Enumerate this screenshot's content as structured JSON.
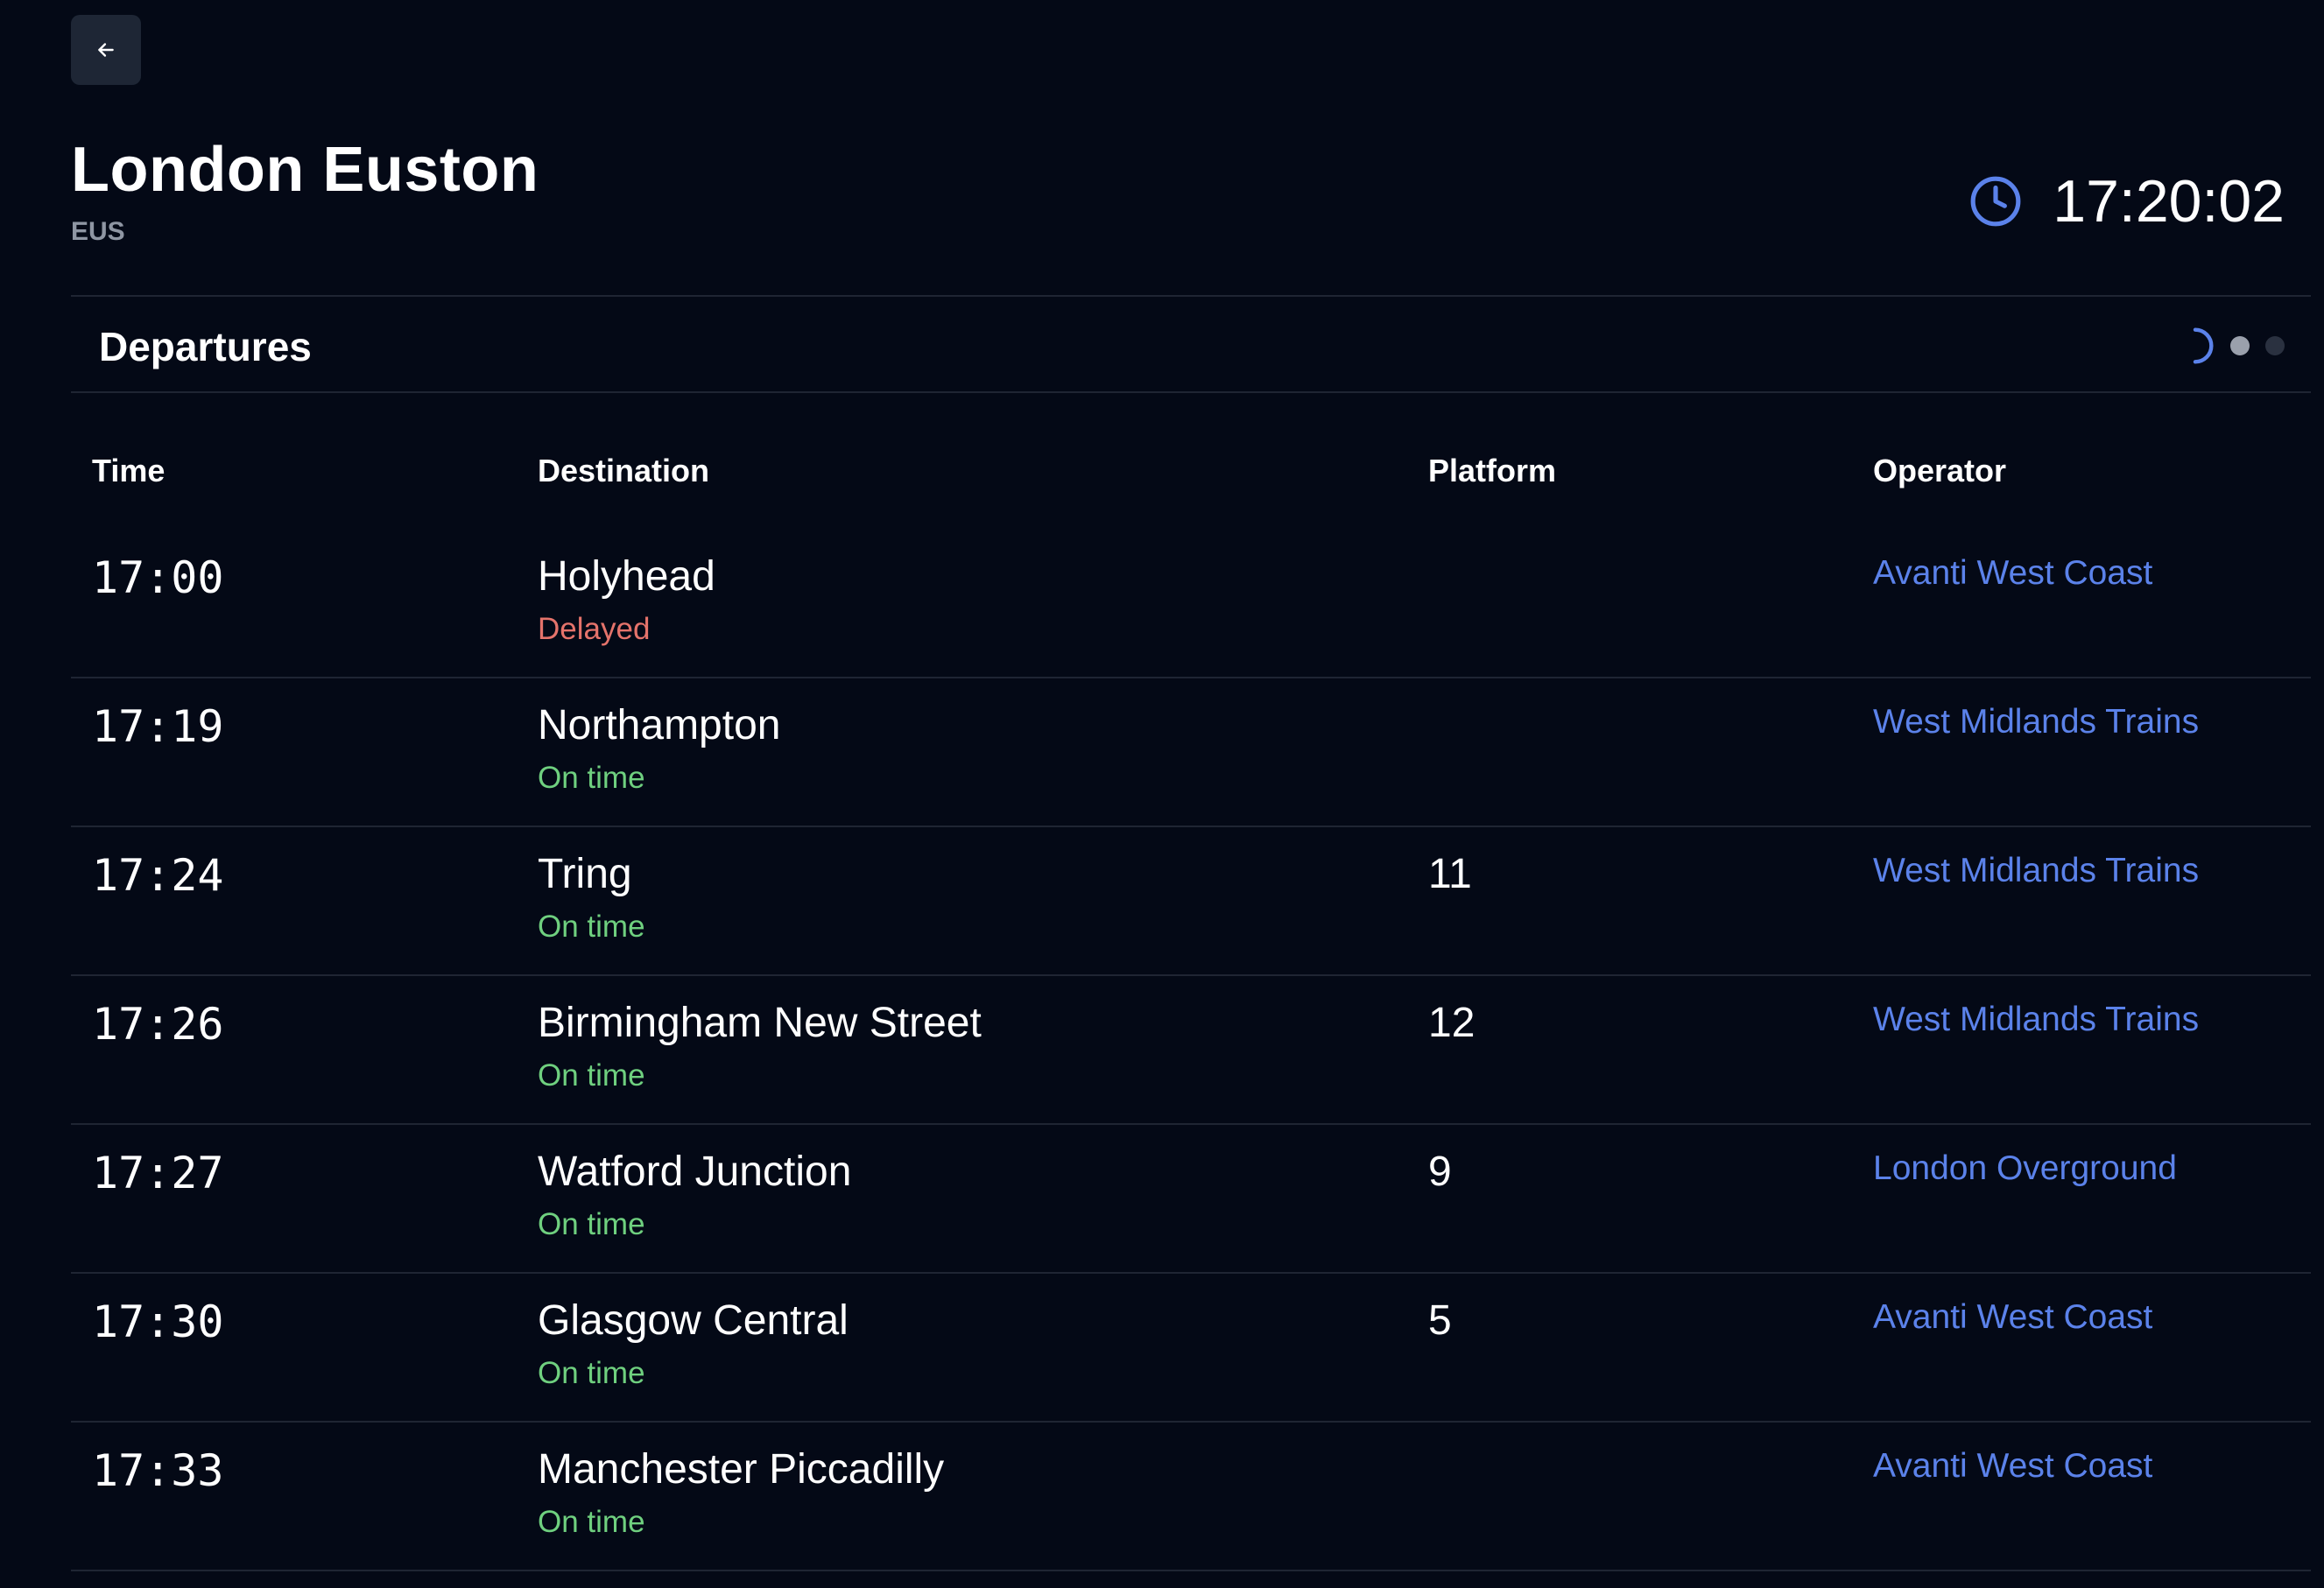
{
  "header": {
    "station_name": "London Euston",
    "station_code": "EUS",
    "current_time": "17:20:02"
  },
  "section": {
    "title": "Departures"
  },
  "columns": {
    "time": "Time",
    "destination": "Destination",
    "platform": "Platform",
    "operator": "Operator"
  },
  "departures": [
    {
      "time": "17:00",
      "destination": "Holyhead",
      "status": "Delayed",
      "platform": "",
      "operator": "Avanti West Coast"
    },
    {
      "time": "17:19",
      "destination": "Northampton",
      "status": "On time",
      "platform": "",
      "operator": "West Midlands Trains"
    },
    {
      "time": "17:24",
      "destination": "Tring",
      "status": "On time",
      "platform": "11",
      "operator": "West Midlands Trains"
    },
    {
      "time": "17:26",
      "destination": "Birmingham New Street",
      "status": "On time",
      "platform": "12",
      "operator": "West Midlands Trains"
    },
    {
      "time": "17:27",
      "destination": "Watford Junction",
      "status": "On time",
      "platform": "9",
      "operator": "London Overground"
    },
    {
      "time": "17:30",
      "destination": "Glasgow Central",
      "status": "On time",
      "platform": "5",
      "operator": "Avanti West Coast"
    },
    {
      "time": "17:33",
      "destination": "Manchester Piccadilly",
      "status": "On time",
      "platform": "",
      "operator": "Avanti West Coast"
    }
  ],
  "icons": {
    "back": "arrow-left-icon",
    "clock": "clock-icon",
    "spinner": "loading-spinner-icon"
  },
  "colors": {
    "background": "#040916",
    "accent": "#5b82ea",
    "delayed": "#e5736b",
    "on_time": "#6fd07f",
    "muted": "#8f96a3"
  }
}
